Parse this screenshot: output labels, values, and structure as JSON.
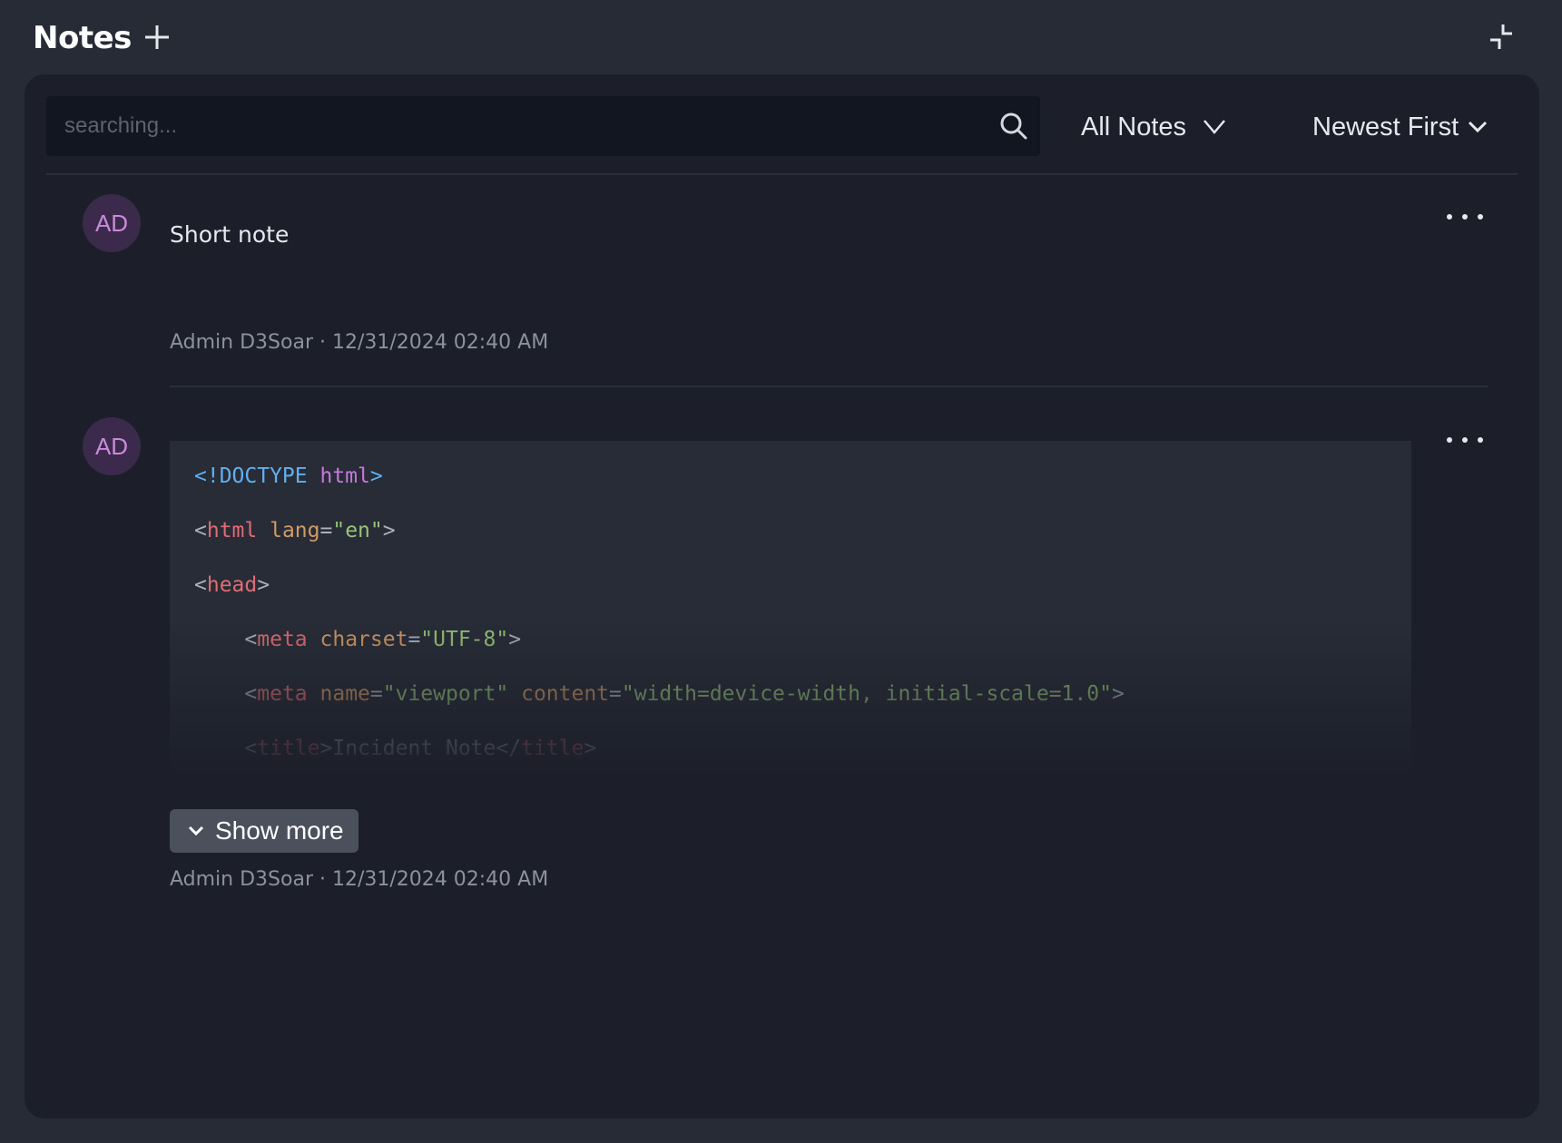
{
  "header": {
    "title": "Notes"
  },
  "toolbar": {
    "search_placeholder": "searching...",
    "filter_label": "All Notes",
    "sort_label": "Newest First"
  },
  "notes": [
    {
      "avatar_initials": "AD",
      "text": "Short note",
      "meta": "Admin D3Soar · 12/31/2024 02:40 AM"
    },
    {
      "avatar_initials": "AD",
      "code_lines": [
        "<!DOCTYPE html>",
        "<html lang=\"en\">",
        "<head>",
        "    <meta charset=\"UTF-8\">",
        "    <meta name=\"viewport\" content=\"width=device-width, initial-scale=1.0\">",
        "    <title>Incident Note</title>"
      ],
      "show_more_label": "Show more",
      "meta": "Admin D3Soar · 12/31/2024 02:40 AM"
    }
  ],
  "colors": {
    "background": "#272b35",
    "panel": "#1c1f29",
    "search_bg": "#121620",
    "avatar_bg": "#3b2a4c",
    "avatar_text": "#c98ad8",
    "code_bg": "#282c36",
    "show_more_bg": "#4b505c"
  },
  "icons": {
    "add": "plus-icon",
    "collapse": "collapse-icon",
    "search": "search-icon",
    "filter": "chevron-down-icon",
    "sort": "chevron-down-icon",
    "menu": "more-horizontal-icon",
    "show_more": "chevron-down-icon"
  }
}
